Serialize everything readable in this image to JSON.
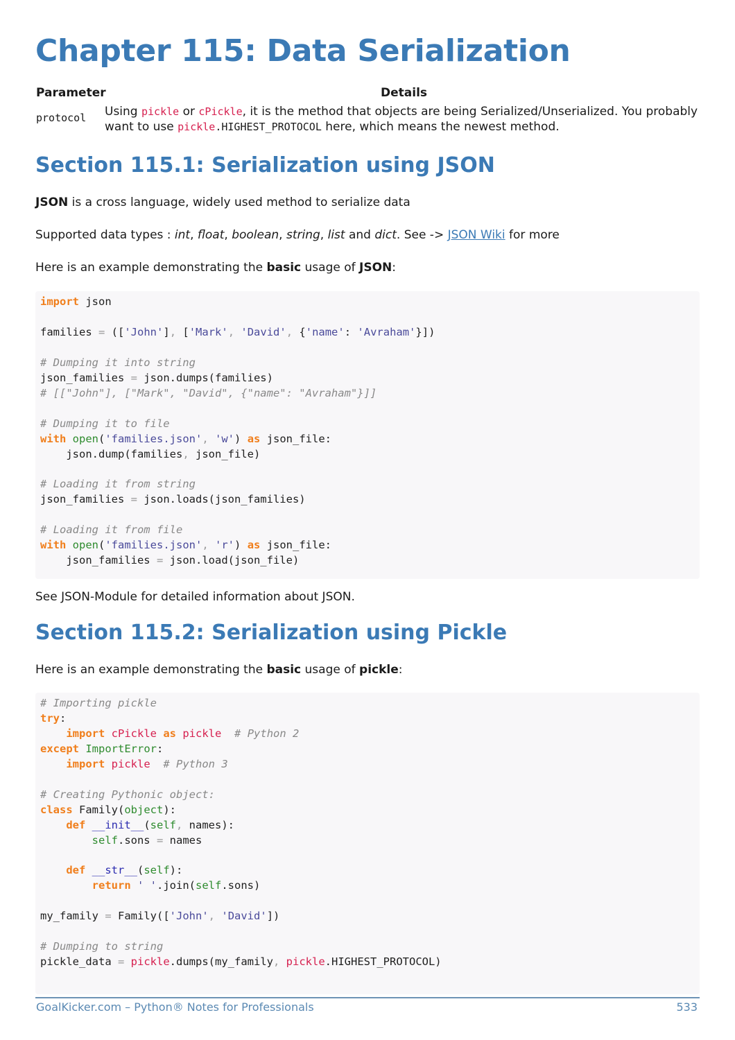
{
  "chapter": {
    "title": "Chapter 115: Data Serialization"
  },
  "param_table": {
    "headers": [
      "Parameter",
      "Details"
    ],
    "rows": [
      {
        "name": "protocol",
        "details": {
          "t1": "Using ",
          "c1": "pickle",
          "t2": " or ",
          "c2": "cPickle",
          "t3": ", it is the method that objects are being Serialized/Unserialized. You probably",
          "t4": "want to use ",
          "c3": "pickle",
          "c4": ".HIGHEST_PROTOCOL",
          "t5": " here, which means the newest method."
        }
      }
    ]
  },
  "section1": {
    "title": "Section 115.1: Serialization using JSON",
    "p1": {
      "bold": "JSON",
      "rest": " is a cross language, widely used method to serialize data"
    },
    "p2": {
      "lead": "Supported data types : ",
      "types": [
        "int",
        "float",
        "boolean",
        "string",
        "list",
        "dict"
      ],
      "sep1": ", ",
      "and": " and ",
      "after": ". See -> ",
      "link": "JSON Wiki",
      "tail": " for more"
    },
    "p3": {
      "lead": "Here is an example demonstrating the ",
      "bold1": "basic",
      "mid": " usage of ",
      "bold2": "JSON",
      "tail": ":"
    },
    "code_lines": [
      "import json",
      "",
      "families = (['John'], ['Mark', 'David', {'name': 'Avraham'}])",
      "",
      "# Dumping it into string",
      "json_families = json.dumps(families)",
      "# [[\"John\"], [\"Mark\", \"David\", {\"name\": \"Avraham\"}]]",
      "",
      "# Dumping it to file",
      "with open('families.json', 'w') as json_file:",
      "    json.dump(families, json_file)",
      "",
      "# Loading it from string",
      "json_families = json.loads(json_families)",
      "",
      "# Loading it from file",
      "with open('families.json', 'r') as json_file:",
      "    json_families = json.load(json_file)"
    ],
    "after_code": "See JSON-Module for detailed information about JSON."
  },
  "section2": {
    "title": "Section 115.2: Serialization using Pickle",
    "p1": {
      "lead": "Here is an example demonstrating the ",
      "bold1": "basic",
      "mid": " usage of ",
      "bold2": "pickle",
      "tail": ":"
    },
    "code_lines": [
      "# Importing pickle",
      "try:",
      "    import cPickle as pickle  # Python 2",
      "except ImportError:",
      "    import pickle  # Python 3",
      "",
      "# Creating Pythonic object:",
      "class Family(object):",
      "    def __init__(self, names):",
      "        self.sons = names",
      "",
      "    def __str__(self):",
      "        return ' '.join(self.sons)",
      "",
      "my_family = Family(['John', 'David'])",
      "",
      "# Dumping to string",
      "pickle_data = pickle.dumps(my_family, pickle.HIGHEST_PROTOCOL)"
    ]
  },
  "footer": {
    "left": "GoalKicker.com – Python® Notes for Professionals",
    "page_number": "533"
  }
}
